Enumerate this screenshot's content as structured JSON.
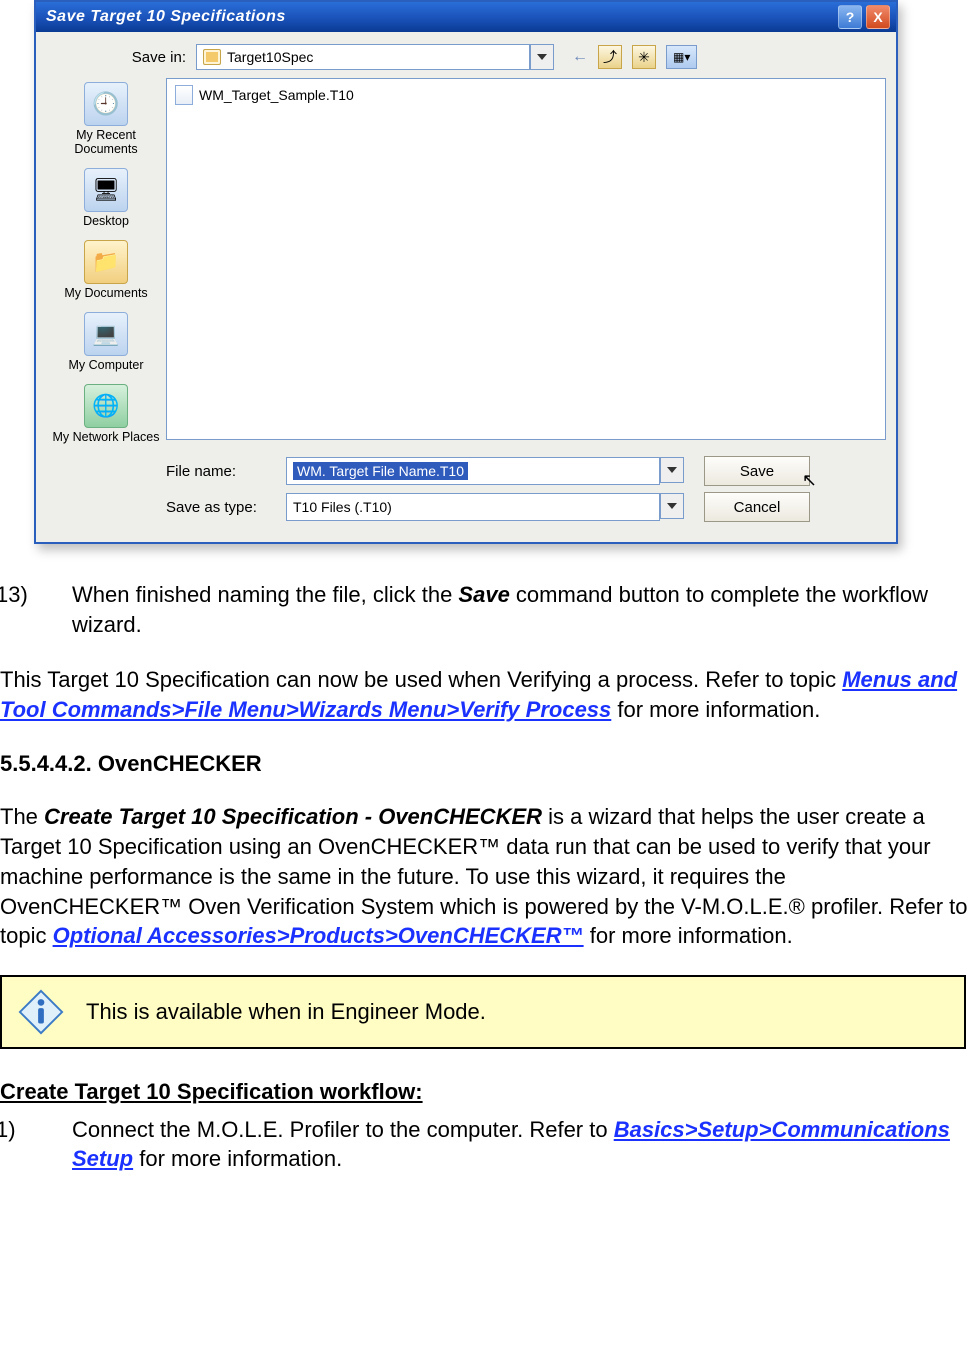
{
  "dialog": {
    "title": "Save Target 10 Specifications",
    "help_glyph": "?",
    "close_glyph": "X",
    "save_in_label": "Save in:",
    "save_in_value": "Target10Spec",
    "back_glyph": "←",
    "up_glyph": "⤴",
    "newfolder_glyph": "✳",
    "tools_label": "▦▾",
    "sidebar": {
      "recent": "My Recent Documents",
      "desktop": "Desktop",
      "mydocs": "My Documents",
      "mycomp": "My Computer",
      "netplaces": "My Network Places"
    },
    "file_list_item": "WM_Target_Sample.T10",
    "filename_label": "File name:",
    "filename_value": "WM. Target File Name.T10",
    "savetype_label": "Save as type:",
    "savetype_value": "T10 Files (.T10)",
    "save_btn": "Save",
    "cancel_btn": "Cancel",
    "cursor_glyph": "↖"
  },
  "doc": {
    "step13_num": "13)",
    "step13_a": "When finished naming the file, click the ",
    "step13_bold": "Save",
    "step13_b": " command button to complete the workflow wizard.",
    "topicpara_a": "This Target 10 Specification can now be used when Verifying a process. Refer to topic ",
    "topicpara_link": "Menus and Tool Commands>File Menu>Wizards Menu>Verify Process",
    "topicpara_b": " for more information.",
    "section_heading": "5.5.4.4.2. OvenCHECKER",
    "oc_a": "The ",
    "oc_bold": "Create Target 10 Specification - OvenCHECKER",
    "oc_b": " is a wizard that helps the user create a Target 10 Specification using an OvenCHECKER™ data run that can be used to verify that your machine performance is the same in the future. To use this wizard, it requires the OvenCHECKER™ Oven Verification System which is powered by the V-M.O.L.E.® profiler. Refer to topic ",
    "oc_link": "Optional Accessories>Products>OvenCHECKER™",
    "oc_c": " for more information.",
    "note": "This is available when in Engineer Mode.",
    "workflow_heading": "Create Target 10 Specification workflow:",
    "step1_num": "1)",
    "step1_a": "Connect the M.O.L.E. Profiler to the computer. Refer to ",
    "step1_link": "Basics>Setup>Communications Setup",
    "step1_b": " for more information."
  }
}
